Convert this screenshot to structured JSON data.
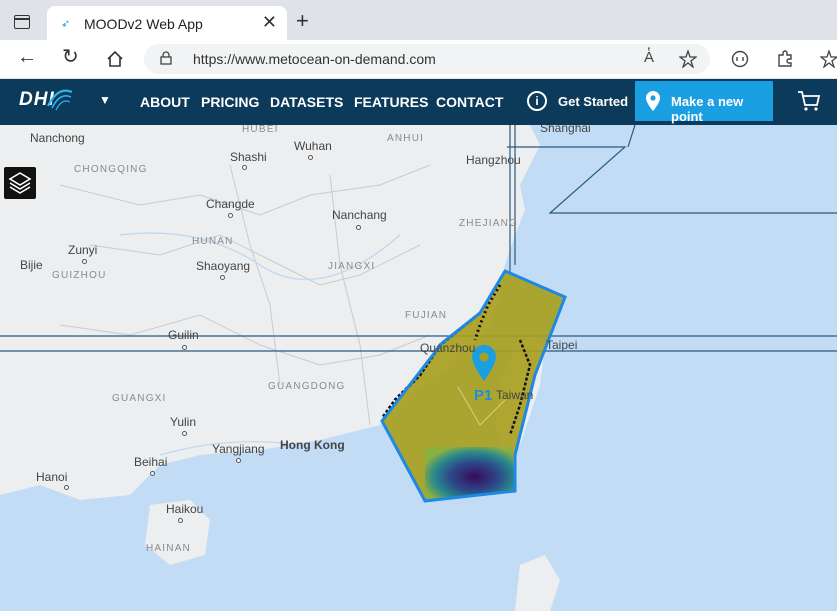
{
  "browser": {
    "tab_title": "MOODv2 Web App",
    "tab_close": "✕",
    "new_tab": "+",
    "url": "https://www.metocean-on-demand.com",
    "read_aloud": "A̔"
  },
  "header": {
    "logo": "DHI",
    "nav": [
      "ABOUT",
      "PRICING",
      "DATASETS",
      "FEATURES",
      "CONTACT"
    ],
    "get_started": "Get Started",
    "make_point": "Make a new point",
    "info_glyph": "i"
  },
  "map": {
    "cities": [
      "Nanchong",
      "Shashi",
      "Wuhan",
      "Anhui",
      "Hangzhou",
      "Shanghai",
      "Changde",
      "Nanchang",
      "Zunyi",
      "Bijie",
      "Shaoyang",
      "Guilin",
      "Quanzhou",
      "Taipei",
      "Taiwan",
      "Yulin",
      "Yangjiang",
      "Hong Kong",
      "Beihai",
      "Hanoi",
      "Haikou"
    ],
    "provinces": [
      "CHONGQING",
      "HUBEI",
      "ANHUI",
      "ZHEJIANG",
      "HUNAN",
      "GUIZHOU",
      "JIANGXI",
      "FUJIAN",
      "GUANGDONG",
      "GUANGXI",
      "HAINAN"
    ],
    "point_label": "P1"
  },
  "colors": {
    "header_bg": "#0b3a5a",
    "accent": "#1a9fe3",
    "sea": "#c2dcf5",
    "land": "#eceef0",
    "region_fill": "#a8a020"
  }
}
